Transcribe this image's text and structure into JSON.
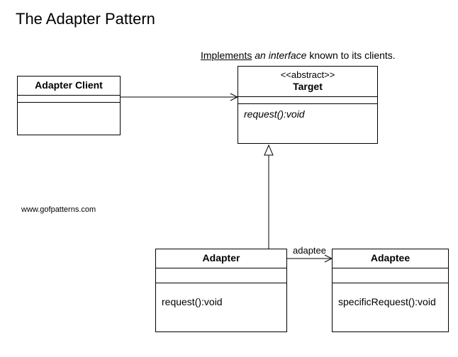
{
  "title": "The Adapter Pattern",
  "caption": {
    "part1": "Implements",
    "part2": "an interface",
    "part3": "known to its clients."
  },
  "footer": "www.gofpatterns.com",
  "classes": {
    "client": {
      "name": "Adapter Client"
    },
    "target": {
      "stereotype": "<<abstract>>",
      "name": "Target",
      "operation": "request():void"
    },
    "adapter": {
      "name": "Adapter",
      "operation": "request():void"
    },
    "adaptee": {
      "name": "Adaptee",
      "operation": "specificRequest():void"
    }
  },
  "relations": {
    "client_to_target": {
      "type": "association",
      "arrow": "open"
    },
    "adapter_to_target": {
      "type": "generalization",
      "arrow": "hollow-triangle"
    },
    "adapter_to_adaptee": {
      "type": "association",
      "label": "adaptee",
      "arrow": "open"
    }
  }
}
